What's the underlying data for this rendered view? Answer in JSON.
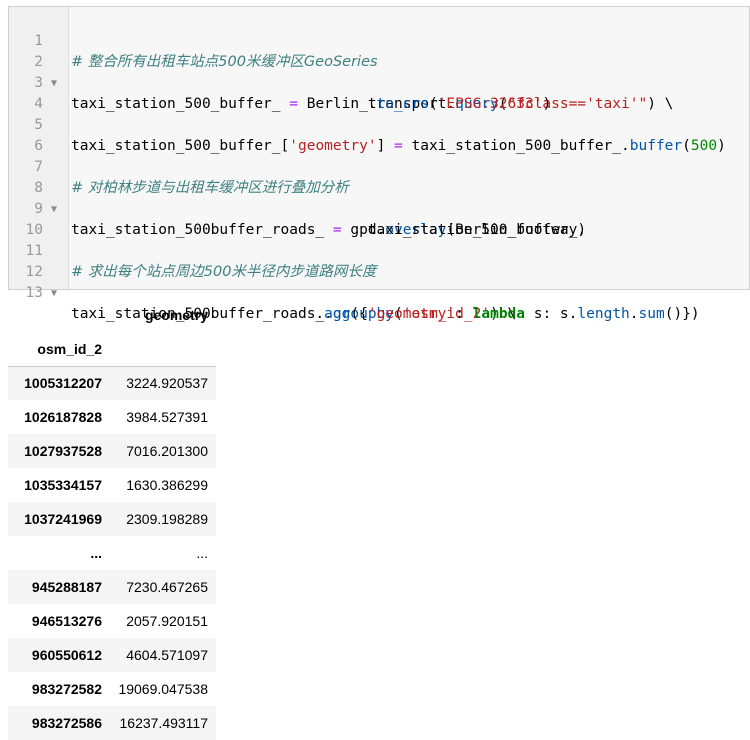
{
  "code_cell": {
    "lines": [
      {
        "n": "1",
        "fold": false
      },
      {
        "n": "2",
        "fold": true
      },
      {
        "n": "3",
        "fold": false
      },
      {
        "n": "4",
        "fold": false
      },
      {
        "n": "5",
        "fold": false
      },
      {
        "n": "6",
        "fold": false
      },
      {
        "n": "7",
        "fold": false
      },
      {
        "n": "8",
        "fold": true
      },
      {
        "n": "9",
        "fold": false
      },
      {
        "n": "10",
        "fold": false
      },
      {
        "n": "11",
        "fold": false
      },
      {
        "n": "12",
        "fold": true
      },
      {
        "n": "13",
        "fold": false
      }
    ],
    "tokens": {
      "l1_comment": "# 整合所有出租车站点500米缓冲区GeoSeries",
      "l2_a": "taxi_station_500_buffer_ ",
      "l2_op": "=",
      "l2_b": " Berlin_transport.",
      "l2_attr": "query",
      "l2_c": "(",
      "l2_str": "\"fclass=='taxi'\"",
      "l2_d": ") \\",
      "l3_pad": "                                  .",
      "l3_attr": "to_crs",
      "l3_a": "(",
      "l3_str": "'EPSG:32633'",
      "l3_b": ")",
      "l5_a": "taxi_station_500_buffer_[",
      "l5_str": "'geometry'",
      "l5_b": "] ",
      "l5_op": "=",
      "l5_c": " taxi_station_500_buffer_.",
      "l5_attr": "buffer",
      "l5_d": "(",
      "l5_num": "500",
      "l5_e": ")",
      "l7_comment": "# 对柏林步道与出租车缓冲区进行叠加分析",
      "l8_a": "taxi_station_500buffer_roads_ ",
      "l8_op": "=",
      "l8_b": " gpd.",
      "l8_attr": "overlay",
      "l8_c": "(Berlin_footway,",
      "l9_a": "                                  taxi_station_500_buffer_)",
      "l11_comment": "# 求出每个站点周边500米半径内步道路网长度",
      "l12_a": "taxi_station_500buffer_roads_.",
      "l12_attr": "groupby",
      "l12_b": "(",
      "l12_str": "'osm_id_2'",
      "l12_c": ") \\",
      "l13_pad": "                            .",
      "l13_attr": "agg",
      "l13_a": "({",
      "l13_str": "'geometry'",
      "l13_b": ": ",
      "l13_kw": "lambda",
      "l13_c": " s: s.",
      "l13_attr2": "length",
      "l13_d": ".",
      "l13_attr3": "sum",
      "l13_e": "()})"
    }
  },
  "output_table": {
    "column_header": "geometry",
    "index_name": "osm_id_2",
    "rows": [
      {
        "index": "1005312207",
        "value": "3224.920537"
      },
      {
        "index": "1026187828",
        "value": "3984.527391"
      },
      {
        "index": "1027937528",
        "value": "7016.201300"
      },
      {
        "index": "1035334157",
        "value": "1630.386299"
      },
      {
        "index": "1037241969",
        "value": "2309.198289"
      },
      {
        "index": "...",
        "value": "..."
      },
      {
        "index": "945288187",
        "value": "7230.467265"
      },
      {
        "index": "946513276",
        "value": "2057.920151"
      },
      {
        "index": "960550612",
        "value": "4604.571097"
      },
      {
        "index": "983272582",
        "value": "19069.047538"
      },
      {
        "index": "983272586",
        "value": "16237.493117"
      }
    ]
  }
}
